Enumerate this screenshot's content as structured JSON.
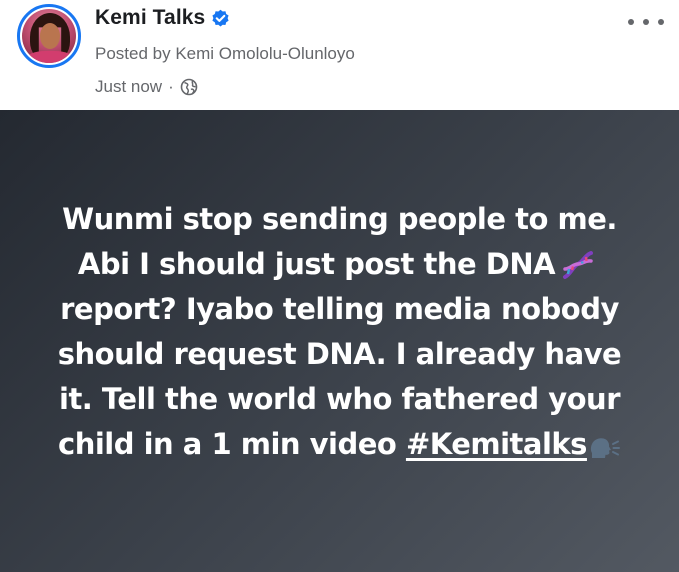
{
  "post": {
    "page_name": "Kemi Talks",
    "posted_by": "Posted by Kemi Omololu-Olunloyo",
    "timestamp": "Just now",
    "separator": "·",
    "audience_icon": "globe-icon",
    "verified_icon": "verified-badge-icon",
    "more_icon": "more-options-icon"
  },
  "body": {
    "text_before_dna": "Wunmi stop sending people to me. Abi I should just post the DNA",
    "dna_emoji": "dna-icon",
    "text_after_dna": "report? Iyabo telling media nobody should request DNA. I already have it. Tell the world who fathered your child in a 1 min video",
    "hashtag": "#Kemitalks",
    "end_emoji": "speaking-head-icon"
  },
  "colors": {
    "brand_blue": "#1877f2",
    "name_text": "#1c1e21",
    "meta_text": "#65676b",
    "post_background_dark": "#242931",
    "post_background_light": "#535962",
    "post_text": "#ffffff"
  }
}
